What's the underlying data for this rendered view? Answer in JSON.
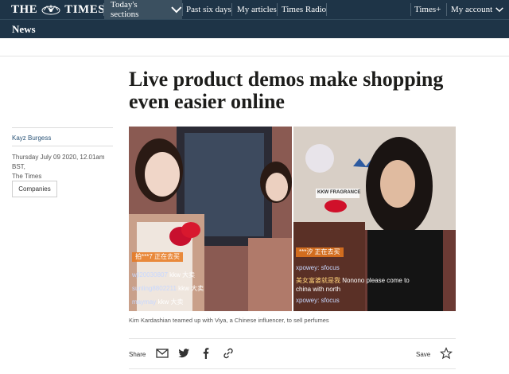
{
  "nav": {
    "logo_left": "THE",
    "logo_right": "TIMES",
    "todays_sections": "Today's sections",
    "past_six_days": "Past six days",
    "my_articles": "My articles",
    "times_radio": "Times Radio",
    "times_plus": "Times+",
    "my_account": "My account"
  },
  "section": {
    "title": "News"
  },
  "article": {
    "headline": "Live product demos make shopping even easier online",
    "author": "Kayz Burgess",
    "date_line1": "Thursday July 09 2020, 12.01am BST,",
    "date_line2": "The Times",
    "tag": "Companies",
    "caption": "Kim Kardashian teamed up with Viya, a Chinese influencer, to sell perfumes"
  },
  "image_overlay": {
    "left_banner": "拍***7 正在去买",
    "left_row1_name": "wjl20030807",
    "left_row1_text": "kkw 大卖",
    "left_row2_name": "sunling8802211",
    "left_row2_text": "kkw 大卖",
    "left_row3_name": "maymay",
    "left_row3_text": "kkw 大卖",
    "right_banner": "***汐 正在去买",
    "right_row1": "xpowey: sfocus",
    "right_row2_name": "美女富婆就是我",
    "right_row2_text": "Nonono please come to",
    "right_row3": "china with north",
    "right_row4": "xpowey: sfocus",
    "brand_sign": "KKW FRAGRANCE"
  },
  "share": {
    "label": "Share",
    "save": "Save"
  },
  "colors": {
    "nav_bg": "#1e3447",
    "nav_active": "#3b5060",
    "author_link": "#2a5377"
  }
}
